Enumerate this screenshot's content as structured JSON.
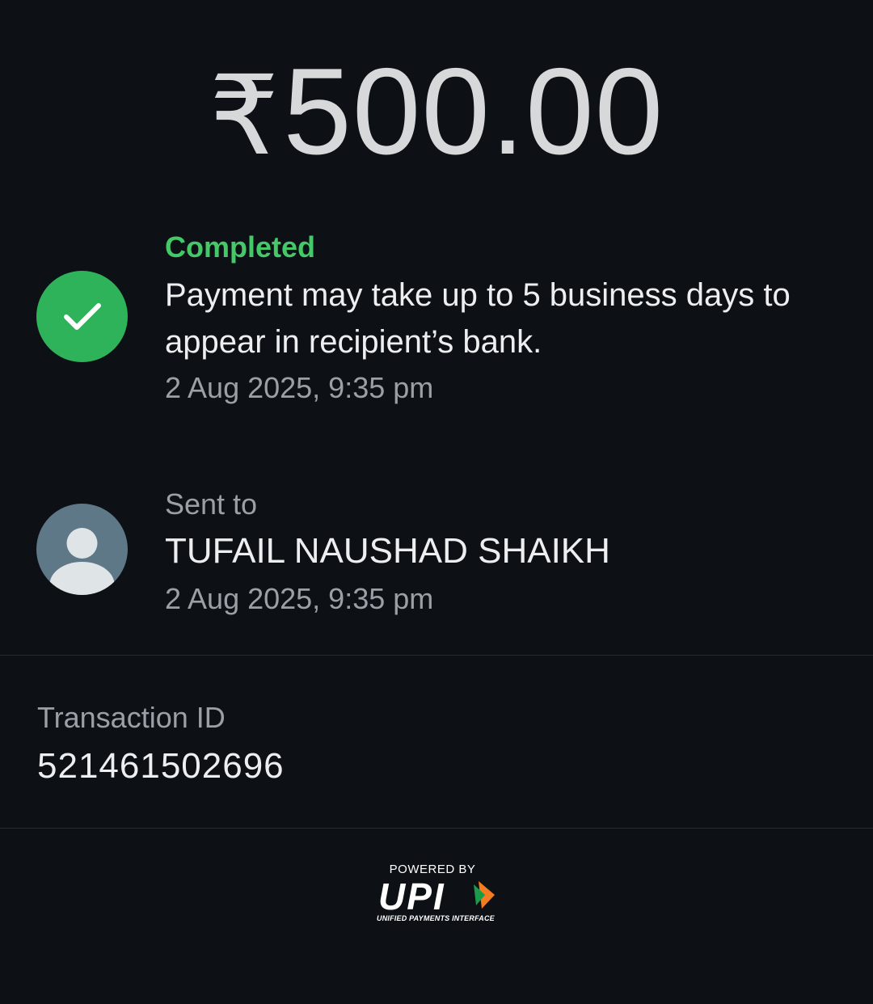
{
  "payment": {
    "currency_symbol": "₹",
    "amount": "500.00"
  },
  "status": {
    "label": "Completed",
    "message": "Payment may take up to 5 business days to appear in recipient’s bank.",
    "timestamp": "2 Aug 2025, 9:35 pm",
    "color": "#45c868",
    "icon": "check-icon"
  },
  "recipient": {
    "label": "Sent to",
    "name": "TUFAIL NAUSHAD SHAIKH",
    "timestamp": "2 Aug 2025, 9:35 pm",
    "icon": "person-avatar-icon"
  },
  "transaction": {
    "label": "Transaction ID",
    "id": "521461502696"
  },
  "footer": {
    "powered_by": "POWERED BY",
    "brand": "UPI",
    "brand_subtitle": "UNIFIED PAYMENTS INTERFACE"
  }
}
